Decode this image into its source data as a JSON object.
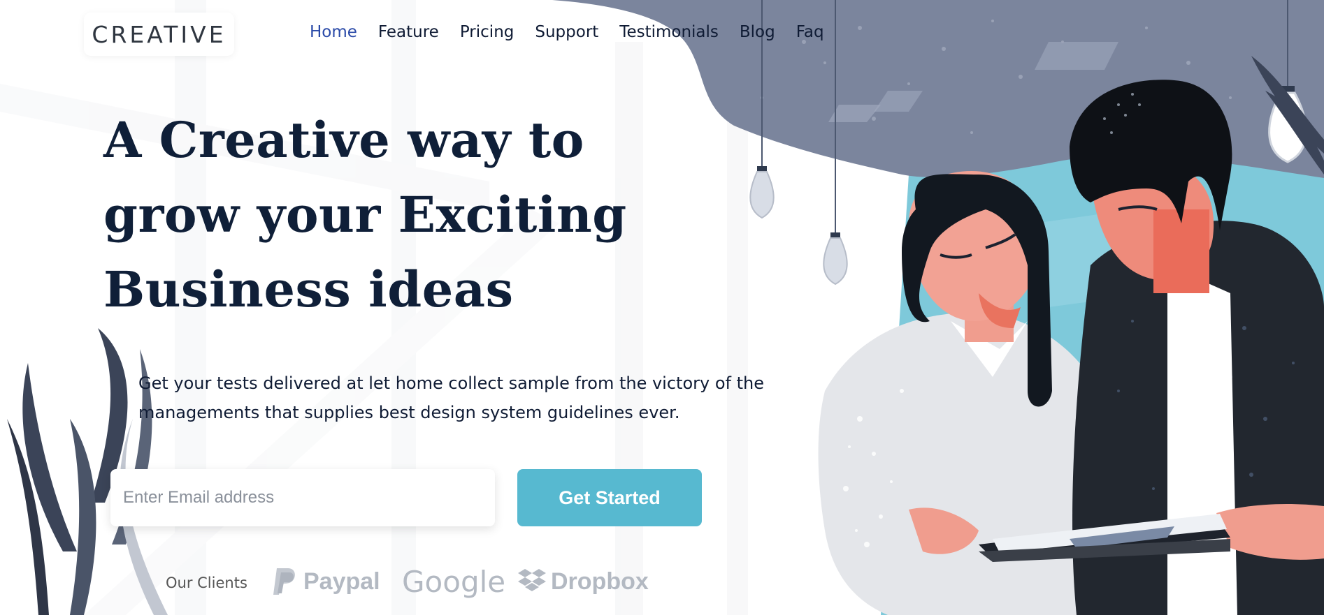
{
  "brand": {
    "logo_text": "CREATIVE"
  },
  "nav": {
    "items": [
      {
        "label": "Home",
        "active": true
      },
      {
        "label": "Feature"
      },
      {
        "label": "Pricing"
      },
      {
        "label": "Support"
      },
      {
        "label": "Testimonials"
      },
      {
        "label": "Blog"
      },
      {
        "label": "Faq"
      }
    ]
  },
  "hero": {
    "title": "A Creative way to grow your Exciting Business ideas",
    "description": "Get your tests delivered at let home collect sample from the victory of the managements that supplies best design system guidelines ever.",
    "email_placeholder": "Enter Email address",
    "cta_label": "Get Started"
  },
  "clients": {
    "label": "Our Clients",
    "logos": [
      {
        "name": "Paypal",
        "icon": "paypal-icon"
      },
      {
        "name": "Google",
        "icon": "google-logo"
      },
      {
        "name": "Dropbox",
        "icon": "dropbox-icon"
      }
    ]
  },
  "colors": {
    "accent": "#57b9d0",
    "nav_active": "#2a4aa8",
    "heading": "#0f1f38",
    "cloud": "#7b859d",
    "client_logo": "#b3b9c2"
  }
}
